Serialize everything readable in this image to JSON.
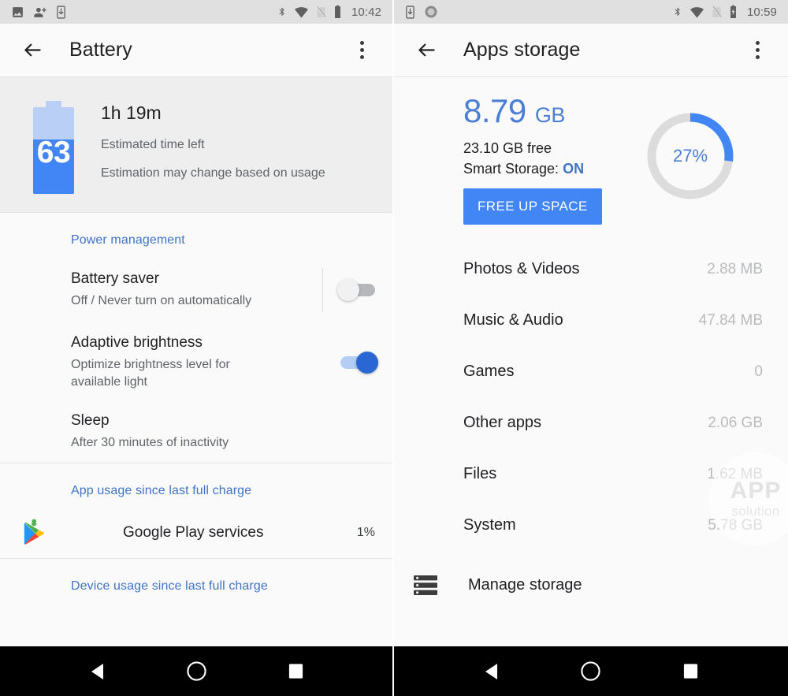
{
  "left_phone": {
    "status_bar": {
      "left_icons": [
        "image-icon",
        "person-add-icon",
        "download-phone-icon"
      ],
      "right_icons": [
        "bluetooth-icon",
        "wifi-icon",
        "no-sim-icon",
        "battery-icon"
      ],
      "time": "10:42"
    },
    "toolbar": {
      "back_icon": "arrow-back-icon",
      "title": "Battery",
      "overflow_icon": "overflow-menu-icon"
    },
    "summary": {
      "battery_percent": "63",
      "battery_fill": 63,
      "time_left": "1h 19m",
      "subtitle": "Estimated time left",
      "note": "Estimation may change based on usage"
    },
    "sections": [
      {
        "title": "Power management",
        "rows": [
          {
            "title": "Battery saver",
            "subtitle": "Off / Never turn on automatically",
            "toggle": "off",
            "divider": true
          },
          {
            "title": "Adaptive brightness",
            "subtitle": "Optimize brightness level for available light",
            "toggle": "on",
            "divider": false
          },
          {
            "title": "Sleep",
            "subtitle": "After 30 minutes of inactivity"
          }
        ]
      },
      {
        "title": "App usage since last full charge",
        "rows": [
          {
            "title": "Google Play services",
            "value": "1%",
            "icon": "google-play-services-icon"
          }
        ]
      },
      {
        "title": "Device usage since last full charge",
        "rows": []
      }
    ],
    "nav_bar": {
      "back": "nav-back-icon",
      "home": "nav-home-icon",
      "recents": "nav-recents-icon"
    }
  },
  "right_phone": {
    "status_bar": {
      "left_icons": [
        "download-phone-icon",
        "record-circle-icon"
      ],
      "right_icons": [
        "bluetooth-icon",
        "wifi-icon",
        "no-sim-icon",
        "battery-charging-icon"
      ],
      "time": "10:59"
    },
    "toolbar": {
      "back_icon": "arrow-back-icon",
      "title": "Apps storage",
      "overflow_icon": "overflow-menu-icon"
    },
    "summary": {
      "used_value": "8.79",
      "used_unit": "GB",
      "free_text": "23.10 GB free",
      "smart_storage_label": "Smart Storage: ",
      "smart_storage_value": "ON",
      "free_up_button": "FREE UP SPACE",
      "donut_percent_label": "27%",
      "donut_percent": 27
    },
    "storage_items": [
      {
        "name": "Photos & Videos",
        "size": "2.88 MB"
      },
      {
        "name": "Music & Audio",
        "size": "47.84 MB"
      },
      {
        "name": "Games",
        "size": "0"
      },
      {
        "name": "Other apps",
        "size": "2.06 GB"
      },
      {
        "name": "Files",
        "size": "1.62 MB"
      },
      {
        "name": "System",
        "size": "5.78 GB"
      }
    ],
    "manage": {
      "icon": "storage-stack-icon",
      "label": "Manage storage"
    },
    "watermark": {
      "line1": "APP",
      "line2": "solution"
    },
    "nav_bar": {
      "back": "nav-back-icon",
      "home": "nav-home-icon",
      "recents": "nav-recents-icon"
    }
  },
  "colors": {
    "accent_blue": "#4285f4",
    "link_blue": "#3f74c4",
    "battery_light": "#b9cff6",
    "donut_track": "#dcdcdc",
    "status_bg": "#e0e0e0",
    "page_bg": "#fafafa"
  }
}
